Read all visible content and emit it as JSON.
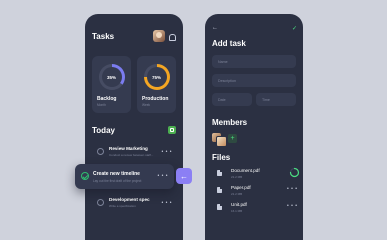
{
  "tasks_screen": {
    "title": "Tasks",
    "cards": [
      {
        "label": "Backlog",
        "sub": "Month",
        "percent": "35%",
        "progress": 0.35,
        "color": "#7b7cf0"
      },
      {
        "label": "Production",
        "sub": "Week",
        "percent": "75%",
        "progress": 0.75,
        "color": "#f4a623"
      }
    ],
    "today_title": "Today",
    "tasks": [
      {
        "title": "Review Marketing",
        "sub": "Conduct a review between staff..."
      },
      {
        "title": "Development spec",
        "sub": "Write a specification"
      }
    ],
    "floating_task": {
      "title": "Create new timeline",
      "sub": "Lay out the first draft of the project"
    },
    "more": "• • •",
    "fab_icon": "arrow-left-icon",
    "accent": "#8b7ff4"
  },
  "add_task_screen": {
    "title": "Add task",
    "fields": {
      "name": "Name",
      "description": "Description",
      "date": "Date",
      "time": "Time"
    },
    "members_title": "Members",
    "add_member": "+",
    "files_title": "Files",
    "files": [
      {
        "name": "Document.pdf",
        "size": "21.2 MB",
        "uploading": true
      },
      {
        "name": "Paper.pdf",
        "size": "21.2 MB",
        "uploading": false
      },
      {
        "name": "Unit.pdf",
        "size": "16.1 MB",
        "uploading": false
      }
    ],
    "more": "• • •",
    "confirm_color": "#4ade80"
  }
}
